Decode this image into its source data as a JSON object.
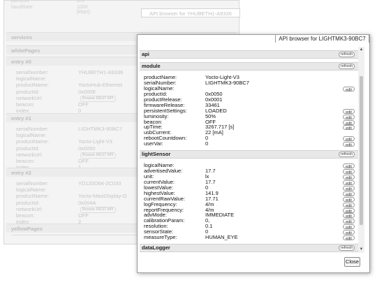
{
  "background": {
    "tab_title": "API browser for YHUBETH1-A9336",
    "top_rows": [
      {
        "key": "parityBit",
        "value": "ON"
      },
      {
        "key": "baudRate:",
        "value": "1000 [kbps]"
      }
    ],
    "sections": [
      {
        "label": "services"
      },
      {
        "label": "whitePages"
      },
      {
        "label": "entry #0"
      },
      {
        "label": "entry #1"
      },
      {
        "label": "entry #2"
      },
      {
        "label": "yellowPages"
      }
    ],
    "entries": [
      {
        "rows": [
          {
            "key": "serialNumber:",
            "value": "YHUBETH1-A9336"
          },
          {
            "key": "logicalName:",
            "value": ""
          },
          {
            "key": "productName:",
            "value": "YoctoHub-Ethernet"
          },
          {
            "key": "productId:",
            "value": "0x000E"
          },
          {
            "key": "networkUrl:",
            "value": "",
            "button": "Browse REST API"
          },
          {
            "key": "beacon:",
            "value": "OFF"
          },
          {
            "key": "index:",
            "value": "0"
          }
        ]
      },
      {
        "rows": [
          {
            "key": "serialNumber:",
            "value": "LIGHTMK3-90BC7"
          },
          {
            "key": "logicalName:",
            "value": ""
          },
          {
            "key": "productName:",
            "value": "Yocto-Light-V3"
          },
          {
            "key": "productId:",
            "value": "0x0050"
          },
          {
            "key": "networkUrl:",
            "value": "",
            "button": "Browse REST API"
          },
          {
            "key": "beacon:",
            "value": "OFF"
          },
          {
            "key": "index:",
            "value": "1"
          }
        ]
      },
      {
        "rows": [
          {
            "key": "serialNumber:",
            "value": "YD120D64-2C033"
          },
          {
            "key": "logicalName:",
            "value": ""
          },
          {
            "key": "productName:",
            "value": "Yocto-MaxiDisplay-G"
          },
          {
            "key": "productId:",
            "value": "0x004A"
          },
          {
            "key": "networkUrl:",
            "value": "",
            "button": "Browse REST API"
          },
          {
            "key": "beacon:",
            "value": "OFF"
          },
          {
            "key": "index:",
            "value": "2"
          }
        ]
      }
    ]
  },
  "dialog": {
    "title": "API browser for LIGHTMK3-90BC7",
    "close_label": "Close",
    "sections": [
      {
        "label": "api",
        "button": "refresh"
      },
      {
        "label": "module",
        "button": "refresh"
      },
      {
        "label": "lightSensor",
        "button": "refresh"
      },
      {
        "label": "dataLogger",
        "button": "refresh"
      }
    ],
    "module_rows": [
      {
        "key": "productName:",
        "value": "Yocto-Light-V3",
        "button": ""
      },
      {
        "key": "serialNumber:",
        "value": "LIGHTMK3-90BC7",
        "button": ""
      },
      {
        "key": "logicalName:",
        "value": "",
        "button": "edit"
      },
      {
        "key": "productId:",
        "value": "0x0050",
        "button": ""
      },
      {
        "key": "productRelease:",
        "value": "0x0001",
        "button": ""
      },
      {
        "key": "firmwareRelease:",
        "value": "33461",
        "button": ""
      },
      {
        "key": "persistentSettings:",
        "value": "LOADED",
        "button": "edit"
      },
      {
        "key": "luminosity:",
        "value": "50%",
        "button": "edit"
      },
      {
        "key": "beacon:",
        "value": "OFF",
        "button": "edit"
      },
      {
        "key": "upTime:",
        "value": "3267.717 [s]",
        "button": "edit"
      },
      {
        "key": "usbCurrent:",
        "value": "22 [mA]",
        "button": ""
      },
      {
        "key": "rebootCountdown:",
        "value": "0",
        "button": "edit"
      },
      {
        "key": "userVar:",
        "value": "0",
        "button": "edit"
      }
    ],
    "lightsensor_rows": [
      {
        "key": "logicalName:",
        "value": "",
        "button": "edit"
      },
      {
        "key": "advertisedValue:",
        "value": "17.7",
        "button": "edit"
      },
      {
        "key": "unit:",
        "value": "lx",
        "button": "edit"
      },
      {
        "key": "currentValue:",
        "value": "17.7",
        "button": "edit"
      },
      {
        "key": "lowestValue:",
        "value": "0",
        "button": "edit"
      },
      {
        "key": "highestValue:",
        "value": "141.9",
        "button": "edit"
      },
      {
        "key": "currentRawValue:",
        "value": "17.71",
        "button": "edit"
      },
      {
        "key": "logFrequency:",
        "value": "4/m",
        "button": "edit"
      },
      {
        "key": "reportFrequency:",
        "value": "4/m",
        "button": "edit"
      },
      {
        "key": "advMode:",
        "value": "IMMEDIATE",
        "button": "edit"
      },
      {
        "key": "calibrationParam:",
        "value": "0,",
        "button": "edit"
      },
      {
        "key": "resolution:",
        "value": "0.1",
        "button": "edit"
      },
      {
        "key": "sensorState:",
        "value": "0",
        "button": "edit"
      },
      {
        "key": "measureType:",
        "value": "HUMAN_EYE",
        "button": "edit"
      }
    ]
  }
}
